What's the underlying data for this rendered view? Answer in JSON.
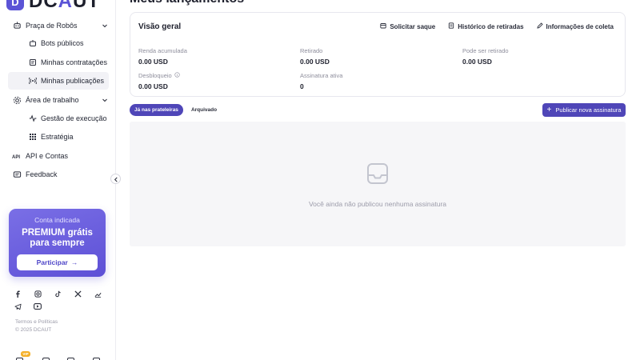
{
  "app": {
    "logo_letter": "D",
    "logo_prefix": "DC",
    "logo_accent": "A",
    "logo_suffix": "UT",
    "page_title": "Meus lançamentos",
    "brand_color": "#5b54d6"
  },
  "sidebar": {
    "groups": [
      {
        "label": "Praça de Robôs",
        "icon": "robot-icon"
      },
      {
        "label": "Área de trabalho",
        "icon": "workspace-icon"
      },
      {
        "label": "API e Contas",
        "icon": "api-icon"
      },
      {
        "label": "Feedback",
        "icon": "feedback-icon"
      }
    ],
    "items": [
      {
        "label": "Bots públicos",
        "icon": "bot-icon"
      },
      {
        "label": "Minhas contratações",
        "icon": "contract-icon"
      },
      {
        "label": "Minhas publicações",
        "icon": "broadcast-icon"
      },
      {
        "label": "Gestão de execução",
        "icon": "activity-icon"
      },
      {
        "label": "Estratégia",
        "icon": "grid-icon"
      }
    ],
    "promo": {
      "small": "Conta indicada",
      "line1": "PREMIUM grátis",
      "line2": "para sempre",
      "button": "Participar",
      "button_arrow": "→"
    },
    "socials": [
      "facebook-icon",
      "instagram-icon",
      "tiktok-icon",
      "x-icon",
      "chart-icon",
      "telegram-icon",
      "youtube-icon"
    ],
    "legal_links": "Termos e Políticas",
    "copyright": "© 2025 DCAUT",
    "vip_badge": "VIP"
  },
  "overview": {
    "title": "Visão geral",
    "actions": [
      {
        "label": "Solicitar saque",
        "icon": "withdraw-icon"
      },
      {
        "label": "Histórico de retiradas",
        "icon": "history-icon"
      },
      {
        "label": "Informações de coleta",
        "icon": "edit-icon"
      }
    ],
    "stats": [
      {
        "label": "Renda acumulada",
        "value": "0.00 USD"
      },
      {
        "label": "Retirado",
        "value": "0.00 USD"
      },
      {
        "label": "Pode ser retirado",
        "value": "0.00 USD"
      },
      {
        "label": "Desbloqueio",
        "value": "0.00 USD"
      },
      {
        "label": "Assinatura ativa",
        "value": "0"
      }
    ]
  },
  "tabs": [
    {
      "label": "Já nas prateleiras",
      "active": true
    },
    {
      "label": "Arquivado",
      "active": false
    }
  ],
  "publish_button": {
    "label": "Publicar nova assinatura",
    "icon_glyph": "+"
  },
  "empty_state": {
    "message": "Você ainda não publicou nenhuma assinatura"
  }
}
